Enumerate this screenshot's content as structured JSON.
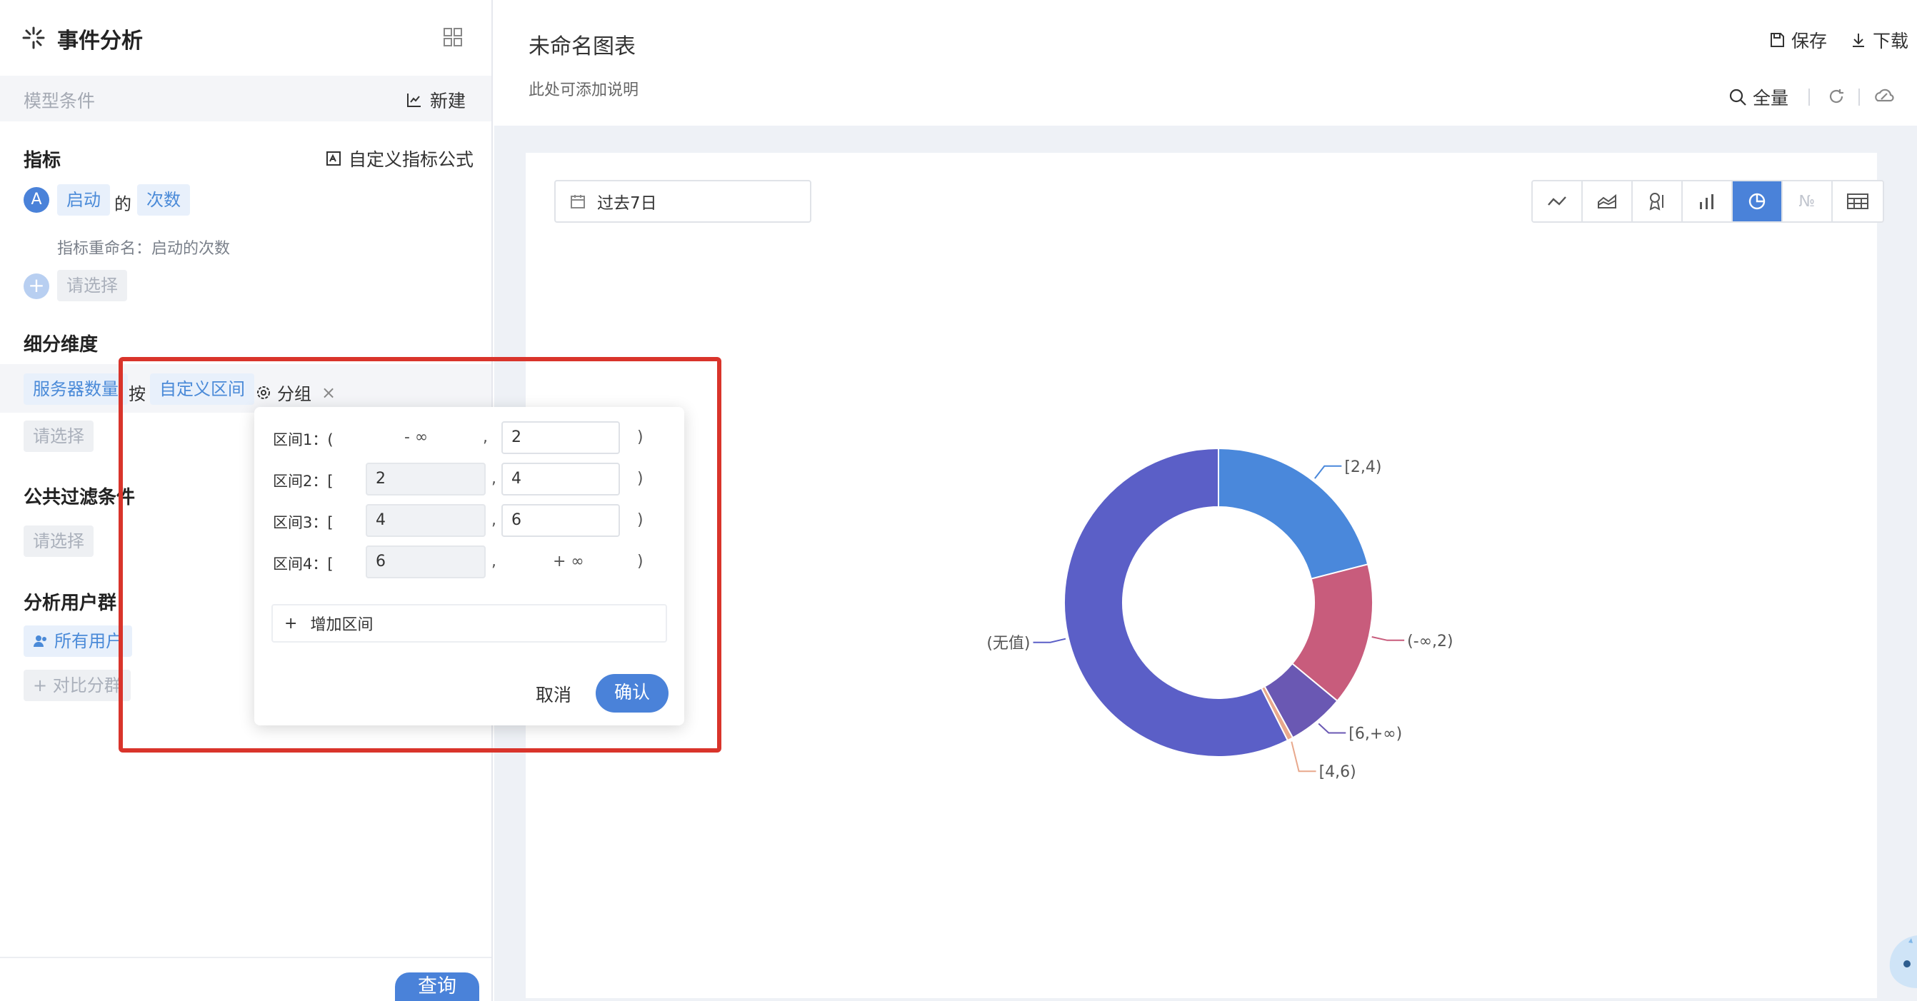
{
  "left_panel": {
    "title": "事件分析",
    "condition_label": "模型条件",
    "new_label": "新建",
    "metrics": {
      "title": "指标",
      "custom_formula": "自定义指标公式",
      "badge": "A",
      "event": "启动",
      "of": "的",
      "measure": "次数",
      "rename": "指标重命名：启动的次数",
      "add_placeholder": "请选择"
    },
    "breakdown": {
      "title": "细分维度",
      "property": "服务器数量",
      "by": "按",
      "mode": "自定义区间",
      "group_label": "分组",
      "add_placeholder": "请选择"
    },
    "filters": {
      "title": "公共过滤条件",
      "add_placeholder": "请选择"
    },
    "user_group": {
      "title": "分析用户群",
      "all_users": "所有用户",
      "compare": "对比分群"
    },
    "query_button": "查询"
  },
  "header": {
    "chart_title": "未命名图表",
    "chart_desc": "此处可添加说明",
    "save": "保存",
    "download": "下载",
    "full": "全量"
  },
  "toolbar": {
    "date_range": "过去7日",
    "chart_types": [
      {
        "icon": "line-chart-icon"
      },
      {
        "icon": "area-chart-icon"
      },
      {
        "icon": "ranking-icon"
      },
      {
        "icon": "bar-chart-icon"
      },
      {
        "icon": "pie-chart-icon",
        "active": true
      },
      {
        "icon": "number-icon",
        "label": "№"
      },
      {
        "icon": "table-icon"
      }
    ]
  },
  "range_popover": {
    "ranges": [
      {
        "label": "区间1：(",
        "from": "- ∞",
        "to": "2"
      },
      {
        "label": "区间2：[",
        "from": "2",
        "to": "4"
      },
      {
        "label": "区间3：[",
        "from": "4",
        "to": "6"
      },
      {
        "label": "区间4：[",
        "from": "6",
        "to": "+ ∞"
      }
    ],
    "comma": ",",
    "close_bracket": ")",
    "add_range": "增加区间",
    "cancel": "取消",
    "confirm": "确认"
  },
  "chart_data": {
    "type": "pie",
    "donut": true,
    "slices": [
      {
        "label": "[2,4)",
        "value": 21,
        "color": "#4a88db"
      },
      {
        "label": "(-∞,2)",
        "value": 15,
        "color": "#c85c7c"
      },
      {
        "label": "[6,+∞)",
        "value": 6,
        "color": "#6a58b3"
      },
      {
        "label": "[4,6)",
        "value": 0.6,
        "color": "#e8a88c"
      },
      {
        "label": "(无值)",
        "value": 57.4,
        "color": "#5b5fc7"
      }
    ]
  }
}
